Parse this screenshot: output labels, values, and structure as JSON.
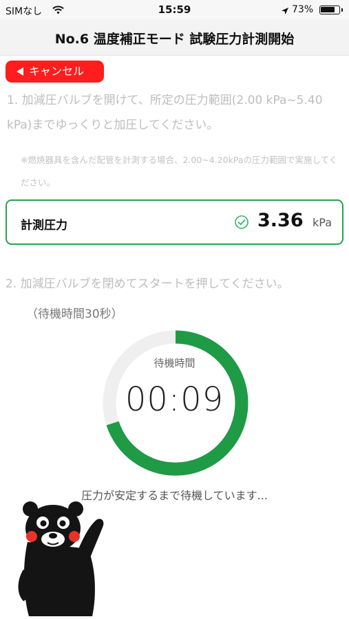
{
  "status_bar": {
    "carrier": "SIMなし",
    "time": "15:59",
    "battery": "73%"
  },
  "header": {
    "title": "No.6 温度補正モード 試験圧力計測開始"
  },
  "cancel_button": {
    "label": "キャンセル"
  },
  "step1": {
    "text": "1. 加減圧バルブを開けて、所定の圧力範囲(2.00 kPa~5.40 kPa)までゆっくりと加圧してください。",
    "note": "※燃焼器具を含んだ配管を計測する場合、2.00~4.20kPaの圧力範囲で実施してください。"
  },
  "pressure": {
    "label": "計測圧力",
    "value": "3.36",
    "unit": "kPa"
  },
  "step2": {
    "text": "2. 加減圧バルブを閉めてスタートを押してください。",
    "sub": "（待機時間30秒）"
  },
  "timer": {
    "label": "待機時間",
    "value": "00:09",
    "progress": 0.7
  },
  "waiting_message": "圧力が安定するまで待機しています...",
  "colors": {
    "accent_green": "#1f9a45",
    "ring_track": "#efefef",
    "cancel_red": "#ff1d1d",
    "header_bg": "#f3f3f3"
  }
}
